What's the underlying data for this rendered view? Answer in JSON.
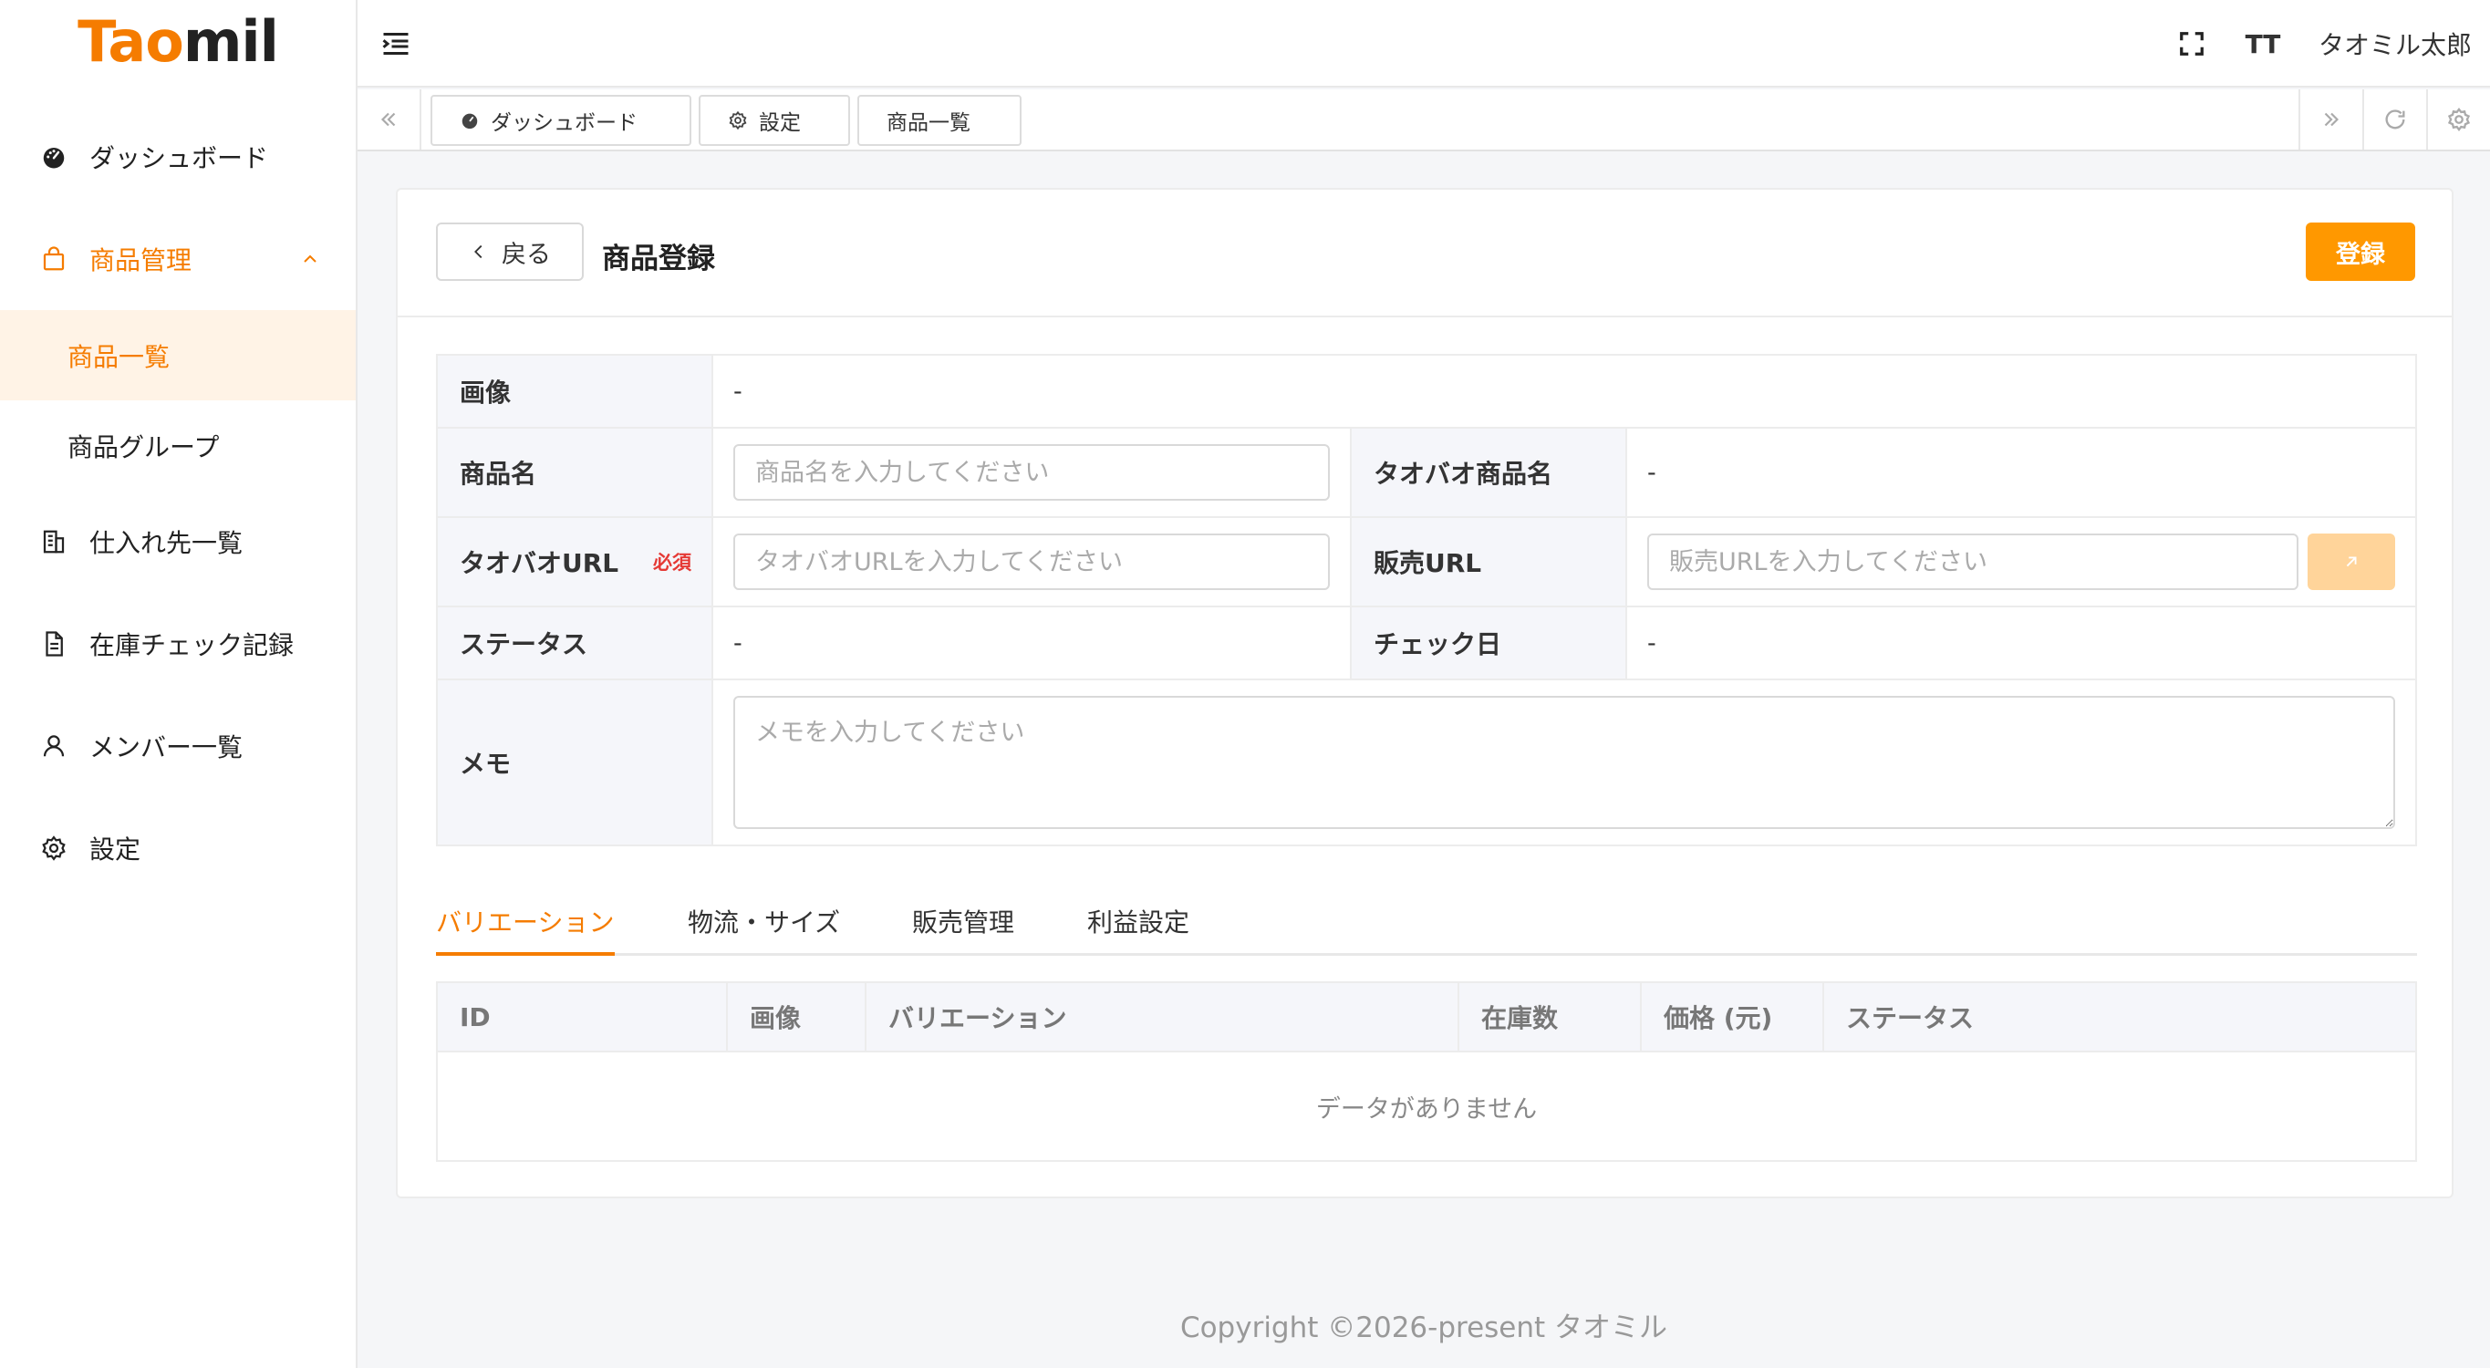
{
  "brand": {
    "logo_prefix": "Tao",
    "logo_suffix": "mil"
  },
  "sidebar": {
    "dashboard": "ダッシュボード",
    "product_mgmt": "商品管理",
    "product_list": "商品一覧",
    "product_group": "商品グループ",
    "suppliers": "仕入れ先一覧",
    "stock_check": "在庫チェック記録",
    "members": "メンバー一覧",
    "settings": "設定"
  },
  "header": {
    "username": "タオミル太郎",
    "font_icon_label": "TT"
  },
  "tabs": [
    "ダッシュボード",
    "設定",
    "商品一覧"
  ],
  "page": {
    "back_label": "戻る",
    "title": "商品登録",
    "submit_label": "登録"
  },
  "form": {
    "image_label": "画像",
    "image_value": "-",
    "product_name_label": "商品名",
    "product_name_placeholder": "商品名を入力してください",
    "taobao_name_label": "タオバオ商品名",
    "taobao_name_value": "-",
    "taobao_url_label": "タオバオURL",
    "required_label": "必須",
    "taobao_url_placeholder": "タオバオURLを入力してください",
    "sales_url_label": "販売URL",
    "sales_url_placeholder": "販売URLを入力してください",
    "status_label": "ステータス",
    "status_value": "-",
    "check_date_label": "チェック日",
    "check_date_value": "-",
    "memo_label": "メモ",
    "memo_placeholder": "メモを入力してください"
  },
  "detail_tabs": [
    "バリエーション",
    "物流・サイズ",
    "販売管理",
    "利益設定"
  ],
  "variation_table": {
    "columns": [
      "ID",
      "画像",
      "バリエーション",
      "在庫数",
      "価格 (元)",
      "ステータス"
    ],
    "empty_text": "データがありません"
  },
  "footer": {
    "copyright": "Copyright ©2026-present タオミル"
  },
  "colors": {
    "accent": "#ff9800",
    "accent_text": "#f57c00",
    "required": "#e53935"
  }
}
